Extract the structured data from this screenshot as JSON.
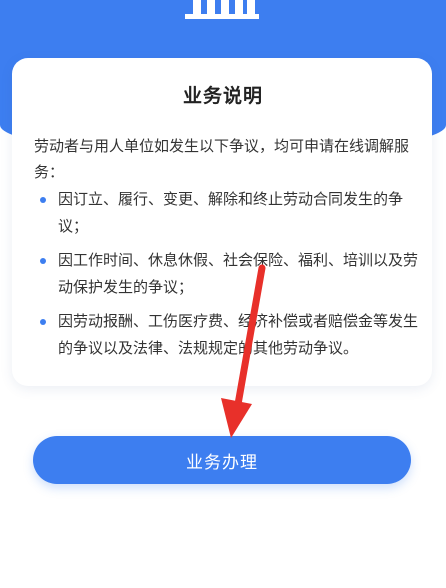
{
  "card": {
    "title": "业务说明",
    "intro": "劳动者与用人单位如发生以下争议，均可申请在线调解服务：",
    "items": [
      "因订立、履行、变更、解除和终止劳动合同发生的争议；",
      "因工作时间、休息休假、社会保险、福利、培训以及劳动保护发生的争议；",
      "因劳动报酬、工伤医疗费、经济补偿或者赔偿金等发生的争议以及法律、法规规定的其他劳动争议。"
    ]
  },
  "action": {
    "button_label": "业务办理"
  },
  "colors": {
    "accent": "#3d7ef0",
    "annotation_arrow": "#e8302a"
  },
  "icons": {
    "header": "building-icon",
    "annotation": "red-arrow-icon"
  }
}
